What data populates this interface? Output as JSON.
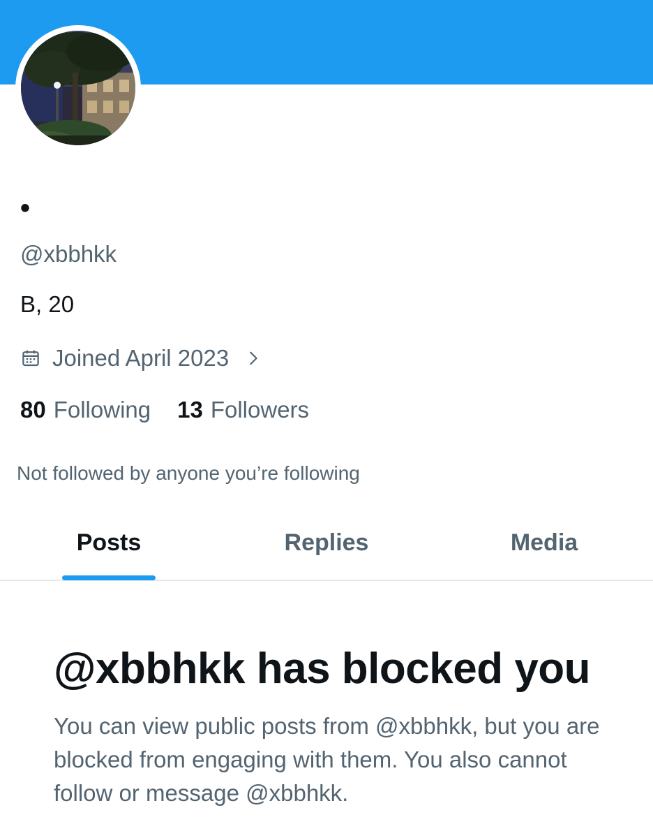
{
  "profile": {
    "banner_color": "#1d9bf0",
    "avatar_icon": "avatar-photo",
    "display_name": "•",
    "handle": "@xbbhkk",
    "bio": "B, 20",
    "joined_icon": "calendar-icon",
    "joined": "Joined April 2023",
    "joined_chevron_icon": "chevron-right-icon"
  },
  "stats": {
    "following_count": "80",
    "following_label": "Following",
    "followers_count": "13",
    "followers_label": "Followers"
  },
  "not_followed_text": "Not followed by anyone you’re following",
  "tabs": [
    {
      "label": "Posts",
      "active": true
    },
    {
      "label": "Replies",
      "active": false
    },
    {
      "label": "Media",
      "active": false
    }
  ],
  "blocked": {
    "title": "@xbbhkk has blocked you",
    "body": "You can view public posts from @xbbhkk, but you are blocked from engaging with them. You also cannot follow or message @xbbhkk."
  },
  "colors": {
    "accent": "#1d9bf0",
    "text_primary": "#0f1419",
    "text_secondary": "#536471"
  }
}
